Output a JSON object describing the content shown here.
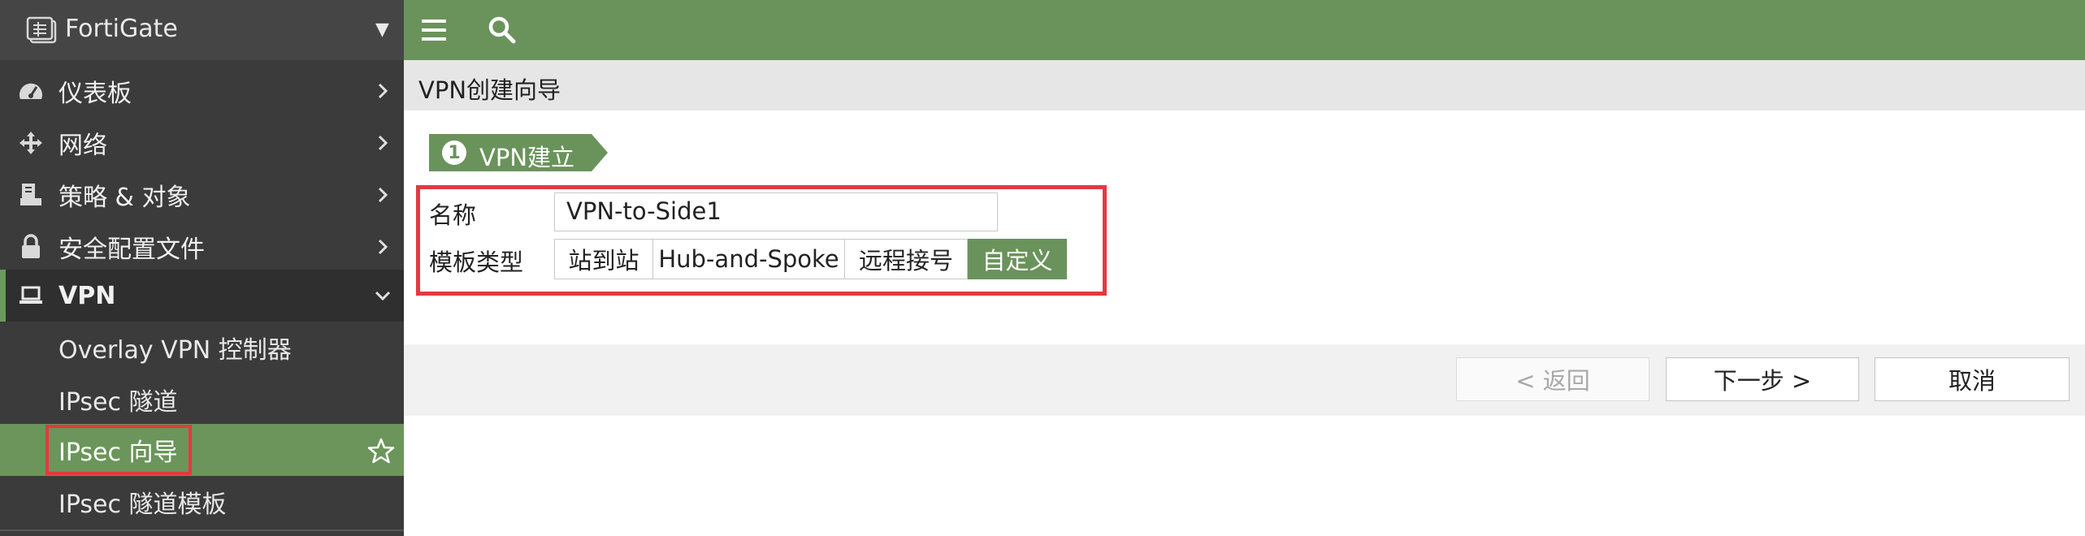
{
  "sidebar": {
    "title": "FortiGate",
    "items": [
      {
        "label": "仪表板",
        "icon": "dashboard-icon"
      },
      {
        "label": "网络",
        "icon": "network-icon"
      },
      {
        "label": "策略 & 对象",
        "icon": "policy-icon"
      },
      {
        "label": "安全配置文件",
        "icon": "lock-icon"
      },
      {
        "label": "VPN",
        "icon": "laptop-icon"
      }
    ],
    "vpn_subitems": [
      {
        "label": "Overlay VPN 控制器"
      },
      {
        "label": "IPsec 隧道"
      },
      {
        "label": "IPsec 向导"
      },
      {
        "label": "IPsec 隧道模板"
      }
    ]
  },
  "breadcrumb": "VPN创建向导",
  "wizard": {
    "step_number": "1",
    "step_label": "VPN建立",
    "name_label": "名称",
    "name_value": "VPN-to-Side1",
    "template_label": "模板类型",
    "template_options": [
      "站到站",
      "Hub-and-Spoke",
      "远程接号",
      "自定义"
    ],
    "selected_template": "自定义"
  },
  "buttons": {
    "back": "< 返回",
    "next": "下一步 >",
    "cancel": "取消"
  },
  "colors": {
    "accent": "#6a935b",
    "sidebar_bg": "#3b3b3b",
    "highlight_border": "#e23a3f"
  }
}
